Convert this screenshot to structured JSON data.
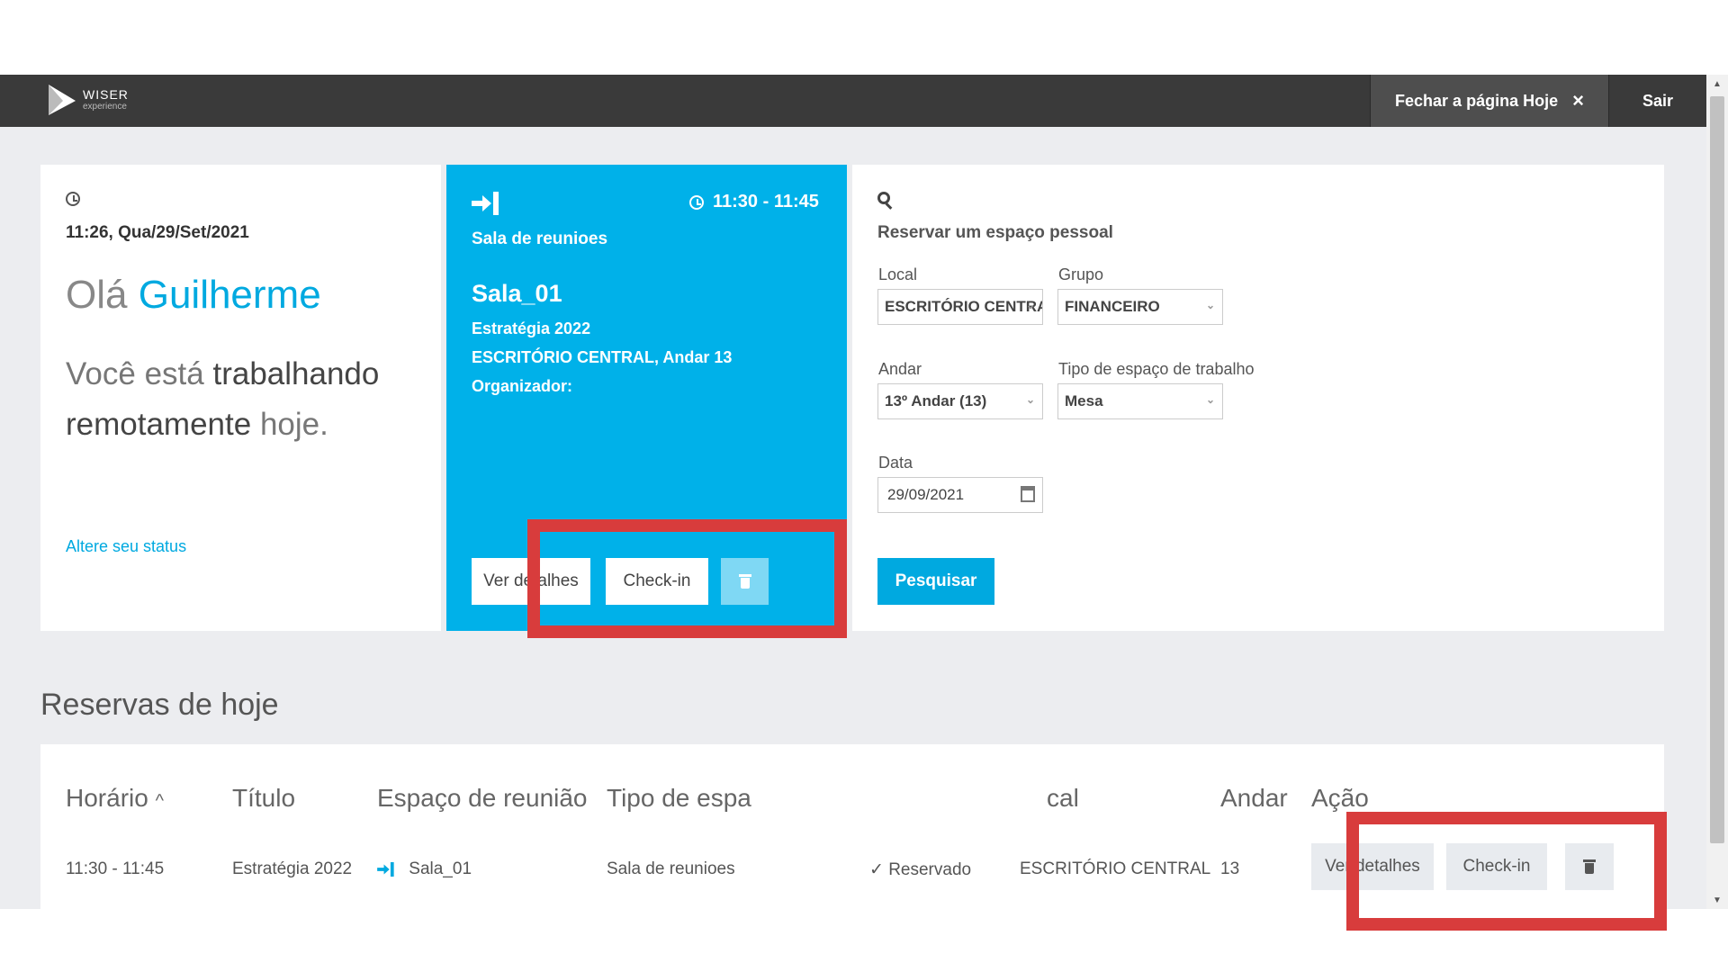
{
  "topbar": {
    "logo_name": "WISER",
    "logo_sub": "experience",
    "close_today_label": "Fechar a página Hoje",
    "close_icon": "×",
    "logout_label": "Sair"
  },
  "status_card": {
    "datetime": "11:26, Qua/29/Set/2021",
    "greeting_prefix": "Olá",
    "user_name": "Guilherme",
    "working_prefix": "Você está",
    "working_status": "trabalhando remotamente",
    "working_suffix": "hoje.",
    "change_status_link": "Altere seu status"
  },
  "booking_card": {
    "time": "11:30 - 11:45",
    "space_type": "Sala de reunioes",
    "room": "Sala_01",
    "title": "Estratégia 2022",
    "location": "ESCRITÓRIO CENTRAL, Andar 13",
    "organizer_label": "Organizador:",
    "details_button": "Ver detalhes",
    "checkin_button": "Check-in",
    "accent_color": "#00b1e9"
  },
  "reserve_card": {
    "title": "Reservar um espaço pessoal",
    "local_label": "Local",
    "local_value": "ESCRITÓRIO CENTRAL",
    "group_label": "Grupo",
    "group_value": "FINANCEIRO",
    "floor_label": "Andar",
    "floor_value": "13º Andar (13)",
    "workspace_type_label": "Tipo de espaço de trabalho",
    "workspace_type_value": "Mesa",
    "date_label": "Data",
    "date_value": "29/09/2021",
    "search_button": "Pesquisar"
  },
  "reservations": {
    "section_title": "Reservas de hoje",
    "columns": {
      "time": "Horário",
      "title": "Título",
      "meeting_space": "Espaço de reunião",
      "space_type": "Tipo de espa",
      "local": "cal",
      "floor": "Andar",
      "action": "Ação"
    },
    "sort_indicator": "^",
    "rows": [
      {
        "time": "11:30 - 11:45",
        "title": "Estratégia 2022",
        "room": "Sala_01",
        "space_type": "Sala de reunioes",
        "status": "Reservado",
        "local": "ESCRITÓRIO CENTRAL",
        "floor": "13",
        "details_button": "Ver detalhes",
        "checkin_button": "Check-in"
      }
    ]
  },
  "highlight_color": "#d83c3c"
}
